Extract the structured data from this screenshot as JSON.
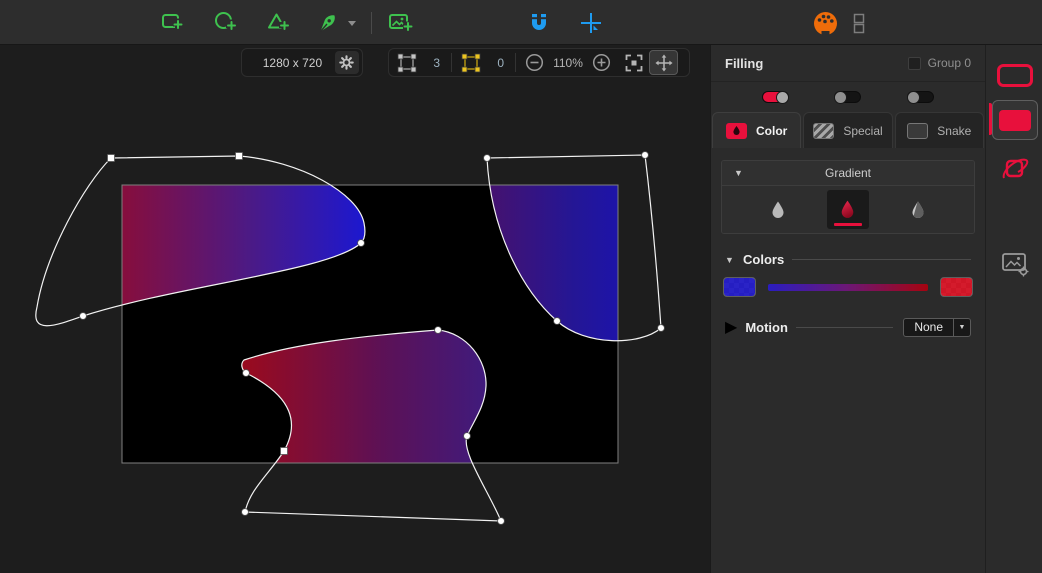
{
  "toolbar": {
    "tools": [
      "add-rectangle",
      "add-ellipse",
      "add-triangle",
      "pen",
      "pen-options",
      "add-image",
      "snapping",
      "add-position",
      "color-palette",
      "layout-panels"
    ]
  },
  "view_bar": {
    "canvas_size": "1280 x 720",
    "path_nodes": "3",
    "selected_nodes": "0",
    "zoom_level": "110%"
  },
  "filling_panel": {
    "title": "Filling",
    "group_label": "Group 0",
    "tabs": {
      "color": "Color",
      "special": "Special",
      "snake": "Snake"
    },
    "fill_type": {
      "title": "Gradient",
      "options": [
        "solid",
        "gradient",
        "two-tone"
      ],
      "selected": "gradient"
    },
    "colors": {
      "title": "Colors",
      "start_hex": "#1a12c8",
      "end_hex": "#d6091c"
    },
    "motion": {
      "title": "Motion",
      "value": "None"
    }
  },
  "sidebar": {
    "items": [
      "stroke",
      "fill",
      "effects",
      "image-settings"
    ],
    "selected": "fill"
  },
  "canvas": {
    "artboard_color": "#000000",
    "shape_gradients": {
      "top_left": [
        "#8c0d36",
        "#4b1a86",
        "#1c18d0"
      ],
      "top_right": [
        "#46126e",
        "#241695",
        "#1712bb"
      ],
      "middle": [
        "#9c0a1c",
        "#5c1156",
        "#3c1c82"
      ]
    }
  },
  "theme": {
    "accent_red": "#e8103c",
    "tool_green": "#3ec14e",
    "tool_blue": "#1e9bf0",
    "tool_orange": "#ee6c0a"
  }
}
